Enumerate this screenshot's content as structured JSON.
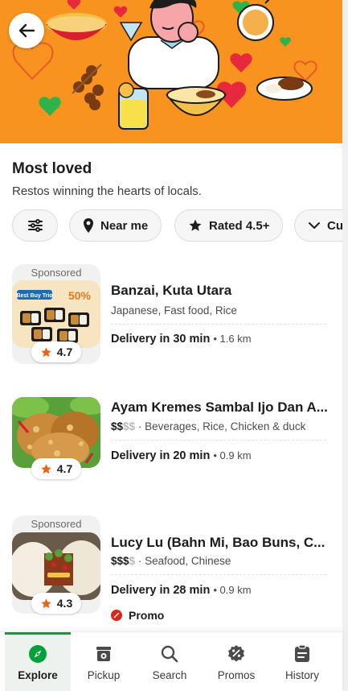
{
  "header": {
    "back_icon": "arrow-left-icon"
  },
  "section": {
    "title": "Most loved",
    "subtitle": "Restos winning the hearts of locals."
  },
  "filters": [
    {
      "label": "",
      "icon": "sliders-icon"
    },
    {
      "label": "Near me",
      "icon": "location-pin-icon"
    },
    {
      "label": "Rated 4.5+",
      "icon": "star-icon"
    },
    {
      "label": "Cu",
      "icon": "chevron-down-icon"
    }
  ],
  "restaurants": [
    {
      "sponsored_label": "Sponsored",
      "rating": "4.7",
      "name": "Banzai, Kuta Utara",
      "price_on": "",
      "price_off": "",
      "categories": "Japanese, Fast food, Rice",
      "delivery_label": "Delivery in 30 min",
      "distance": "1.6 km",
      "promo": "",
      "thumb_text": {
        "badge": "Best Buy Trio",
        "discount": "50%"
      }
    },
    {
      "sponsored_label": "",
      "rating": "4.7",
      "name": "Ayam Kremes Sambal Ijo Dan A...",
      "price_on": "$$",
      "price_off": "$$",
      "categories": "Beverages, Rice, Chicken & duck",
      "delivery_label": "Delivery in 20 min",
      "distance": "0.9 km",
      "promo": ""
    },
    {
      "sponsored_label": "Sponsored",
      "rating": "4.3",
      "name": "Lucy Lu (Bahn Mi, Bao Buns, C...",
      "price_on": "$$$",
      "price_off": "$",
      "categories": "Seafood, Chinese",
      "delivery_label": "Delivery in 28 min",
      "distance": "0.9 km",
      "promo": "Promo"
    }
  ],
  "bottom_nav": [
    {
      "label": "Explore",
      "icon": "compass-icon",
      "active": true
    },
    {
      "label": "Pickup",
      "icon": "store-icon",
      "active": false
    },
    {
      "label": "Search",
      "icon": "search-icon",
      "active": false
    },
    {
      "label": "Promos",
      "icon": "percent-badge-icon",
      "active": false
    },
    {
      "label": "History",
      "icon": "clipboard-icon",
      "active": false
    }
  ],
  "colors": {
    "brand_orange": "#f7931e",
    "accent_green": "#00a13a",
    "rating_star": "#e8641b",
    "promo_red": "#e2231a"
  }
}
